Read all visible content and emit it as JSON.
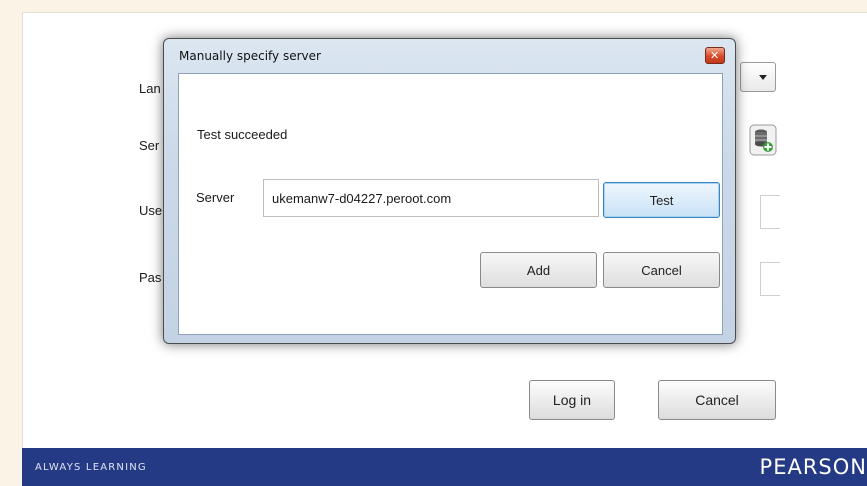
{
  "background_form": {
    "labels": [
      "Lan",
      "Ser",
      "Use",
      "Pas"
    ],
    "login_button": "Log in",
    "cancel_button": "Cancel"
  },
  "footer": {
    "tagline": "ALWAYS LEARNING",
    "brand": "PEARSON"
  },
  "dialog": {
    "title": "Manually specify server",
    "status": "Test succeeded",
    "server_label": "Server",
    "server_value": "ukemanw7-d04227.peroot.com",
    "test_button": "Test",
    "add_button": "Add",
    "cancel_button": "Cancel"
  },
  "colors": {
    "footer_bg": "#253a85",
    "focus_border": "#3b84c4",
    "close_red": "#d8492a"
  }
}
